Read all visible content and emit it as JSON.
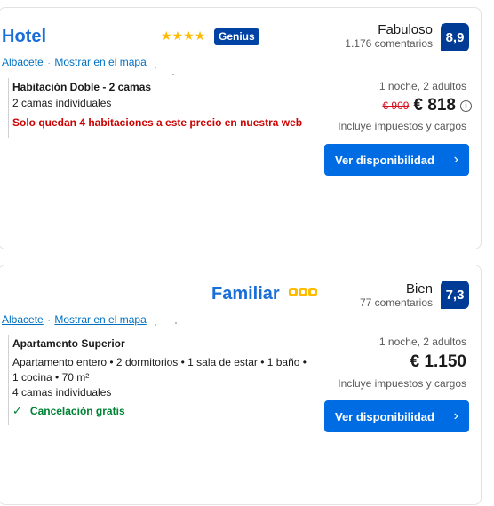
{
  "cards": [
    {
      "title": "Hotel",
      "genius": "Genius",
      "location": "Albacete",
      "map_link": "Mostrar en el mapa",
      "rating_word": "Fabuloso",
      "reviews": "1.176 comentarios",
      "score": "8,9",
      "room_name": "Habitación Doble - 2 camas",
      "room_lines": [
        "2 camas individuales"
      ],
      "warning": "Solo quedan 4 habitaciones a este precio en nuestra web",
      "nights": "1 noche, 2 adultos",
      "old_price": "€ 909",
      "price": "€ 818",
      "info_icon": "i",
      "taxes": "Incluye impuestos y cargos",
      "button": "Ver disponibilidad",
      "stars": 4
    },
    {
      "title": "Familiar",
      "location": "Albacete",
      "map_link": "Mostrar en el mapa",
      "rating_word": "Bien",
      "reviews": "77 comentarios",
      "score": "7,3",
      "room_name": "Apartamento Superior",
      "room_lines": [
        "Apartamento entero • 2 dormitorios • 1 sala de estar • 1 baño •",
        "1 cocina • 70 m²",
        "4 camas individuales"
      ],
      "cancellation": "Cancelación gratis",
      "nights": "1 noche, 2 adultos",
      "price": "€ 1.150",
      "taxes": "Incluye impuestos y cargos",
      "button": "Ver disponibilidad",
      "apartment_rating": 3
    }
  ],
  "colors": {
    "title": "#1a6ed8",
    "score_bg": "#003b95",
    "genius_bg": "#0043a5",
    "button_bg": "#006ce4",
    "warning": "#cc0000",
    "cancel": "#008234",
    "star": "#febb02"
  }
}
